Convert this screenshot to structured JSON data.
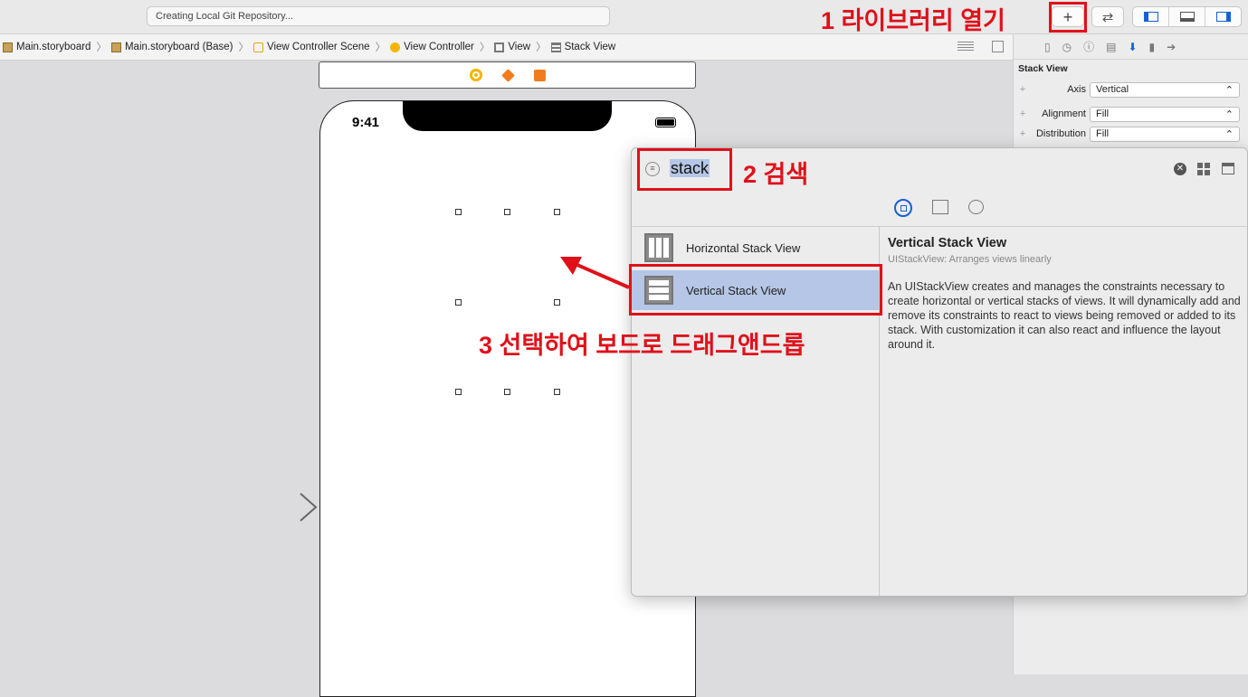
{
  "toolbar": {
    "activity_text": "Creating Local Git Repository...",
    "library_button_glyph": "+",
    "swap_button_glyph": "⇄"
  },
  "breadcrumbs": [
    "Main.storyboard",
    "Main.storyboard (Base)",
    "View Controller Scene",
    "View Controller",
    "View",
    "Stack View"
  ],
  "inspector": {
    "section_title": "Stack View",
    "rows": [
      {
        "label": "Axis",
        "value": "Vertical"
      },
      {
        "label": "Alignment",
        "value": "Fill"
      },
      {
        "label": "Distribution",
        "value": "Fill"
      }
    ]
  },
  "device": {
    "time": "9:41"
  },
  "library": {
    "search_value": "stack",
    "items": [
      {
        "title": "Horizontal Stack View",
        "selected": false
      },
      {
        "title": "Vertical Stack View",
        "selected": true
      }
    ],
    "detail": {
      "title": "Vertical Stack View",
      "subtitle": "UIStackView: Arranges views linearly",
      "description": "An UIStackView creates and manages the constraints necessary to create horizontal or vertical stacks of views. It will dynamically add and remove its constraints to react to views being removed or added to its stack. With customization it can also react and influence the layout around it."
    }
  },
  "annotations": {
    "step1": "1 라이브러리 열기",
    "step2": "2 검색",
    "step3": "3 선택하여 보드로 드래그앤드롭"
  },
  "colors": {
    "annotation_red": "#e0101a",
    "selection_blue": "#b5c6e6",
    "accent_blue": "#1560d8"
  }
}
